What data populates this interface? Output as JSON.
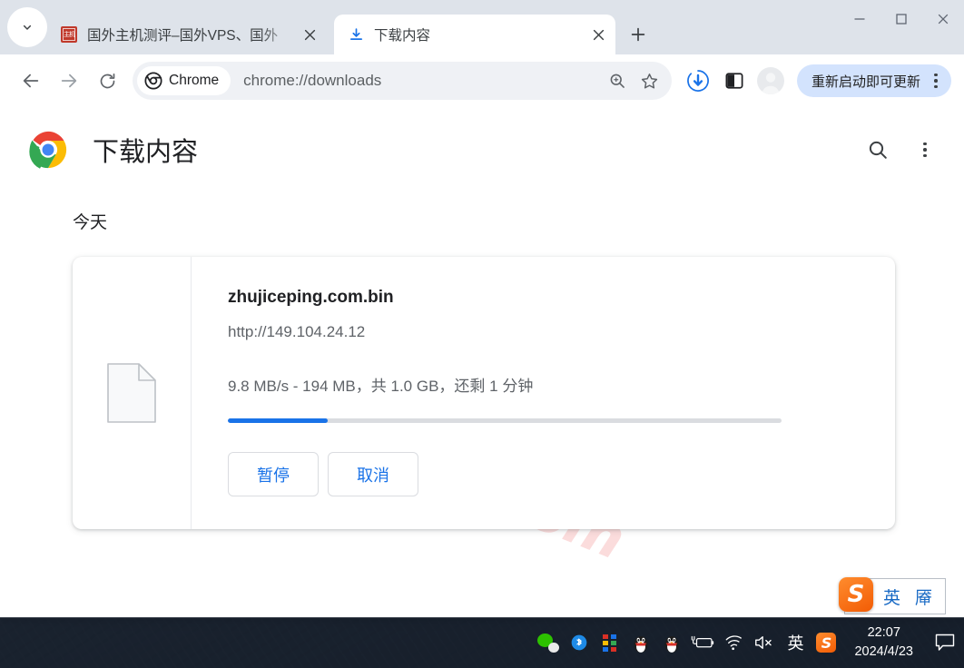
{
  "window": {
    "controls": {
      "minimize": "—",
      "maximize": "☐",
      "close": "✕"
    }
  },
  "tabstrip": {
    "tab_search_icon": "chevron-down-icon",
    "tabs": [
      {
        "title": "国外主机测评–国外VPS、国外",
        "favicon": "red-seal-favicon",
        "favicon_text": "主机",
        "active": false,
        "close_label": "✕"
      },
      {
        "title": "下载内容",
        "favicon": "download-icon",
        "active": true,
        "close_label": "✕"
      }
    ],
    "new_tab_label": "+"
  },
  "toolbar": {
    "back_icon": "arrow-left-icon",
    "forward_icon": "arrow-right-icon",
    "reload_icon": "reload-icon",
    "chrome_chip_label": "Chrome",
    "url": "chrome://downloads",
    "zoom_icon": "zoom-search-icon",
    "bookmark_icon": "star-icon",
    "downloads_icon": "downloads-tray-icon",
    "sidepanel_icon": "side-panel-icon",
    "avatar_icon": "profile-avatar",
    "update_label": "重新启动即可更新",
    "menu_icon": "three-dot-menu-icon"
  },
  "page": {
    "logo": "chrome-logo",
    "title": "下载内容",
    "search_icon": "search-icon",
    "menu_icon": "three-dot-menu-icon",
    "watermark": "zhujiceping.com",
    "section_label": "今天",
    "download": {
      "file_icon": "generic-file-icon",
      "file_name": "zhujiceping.com.bin",
      "url": "http://149.104.24.12",
      "status": "9.8 MB/s - 194 MB，共 1.0 GB，还剩 1 分钟",
      "progress_percent": 18,
      "progress_color": "#1a73e8",
      "pause_label": "暂停",
      "cancel_label": "取消"
    }
  },
  "ime_floating": {
    "logo_text": "S",
    "mode": "英",
    "glyph": "厣"
  },
  "taskbar": {
    "tray": [
      {
        "name": "wechat-icon",
        "glyph": ""
      },
      {
        "name": "bluetooth-icon",
        "glyph": "ᛗ"
      },
      {
        "name": "color-dots-icon",
        "glyph": ""
      },
      {
        "name": "qq-icon-1",
        "glyph": "🐧"
      },
      {
        "name": "qq-icon-2",
        "glyph": "🐧"
      },
      {
        "name": "battery-charging-icon",
        "glyph": ""
      },
      {
        "name": "wifi-icon",
        "glyph": ""
      },
      {
        "name": "volume-muted-icon",
        "glyph": ""
      },
      {
        "name": "ime-language-icon",
        "glyph": "英"
      },
      {
        "name": "sogou-icon",
        "glyph": "S"
      }
    ],
    "time": "22:07",
    "date": "2024/4/23",
    "notification_icon": "notification-icon"
  }
}
